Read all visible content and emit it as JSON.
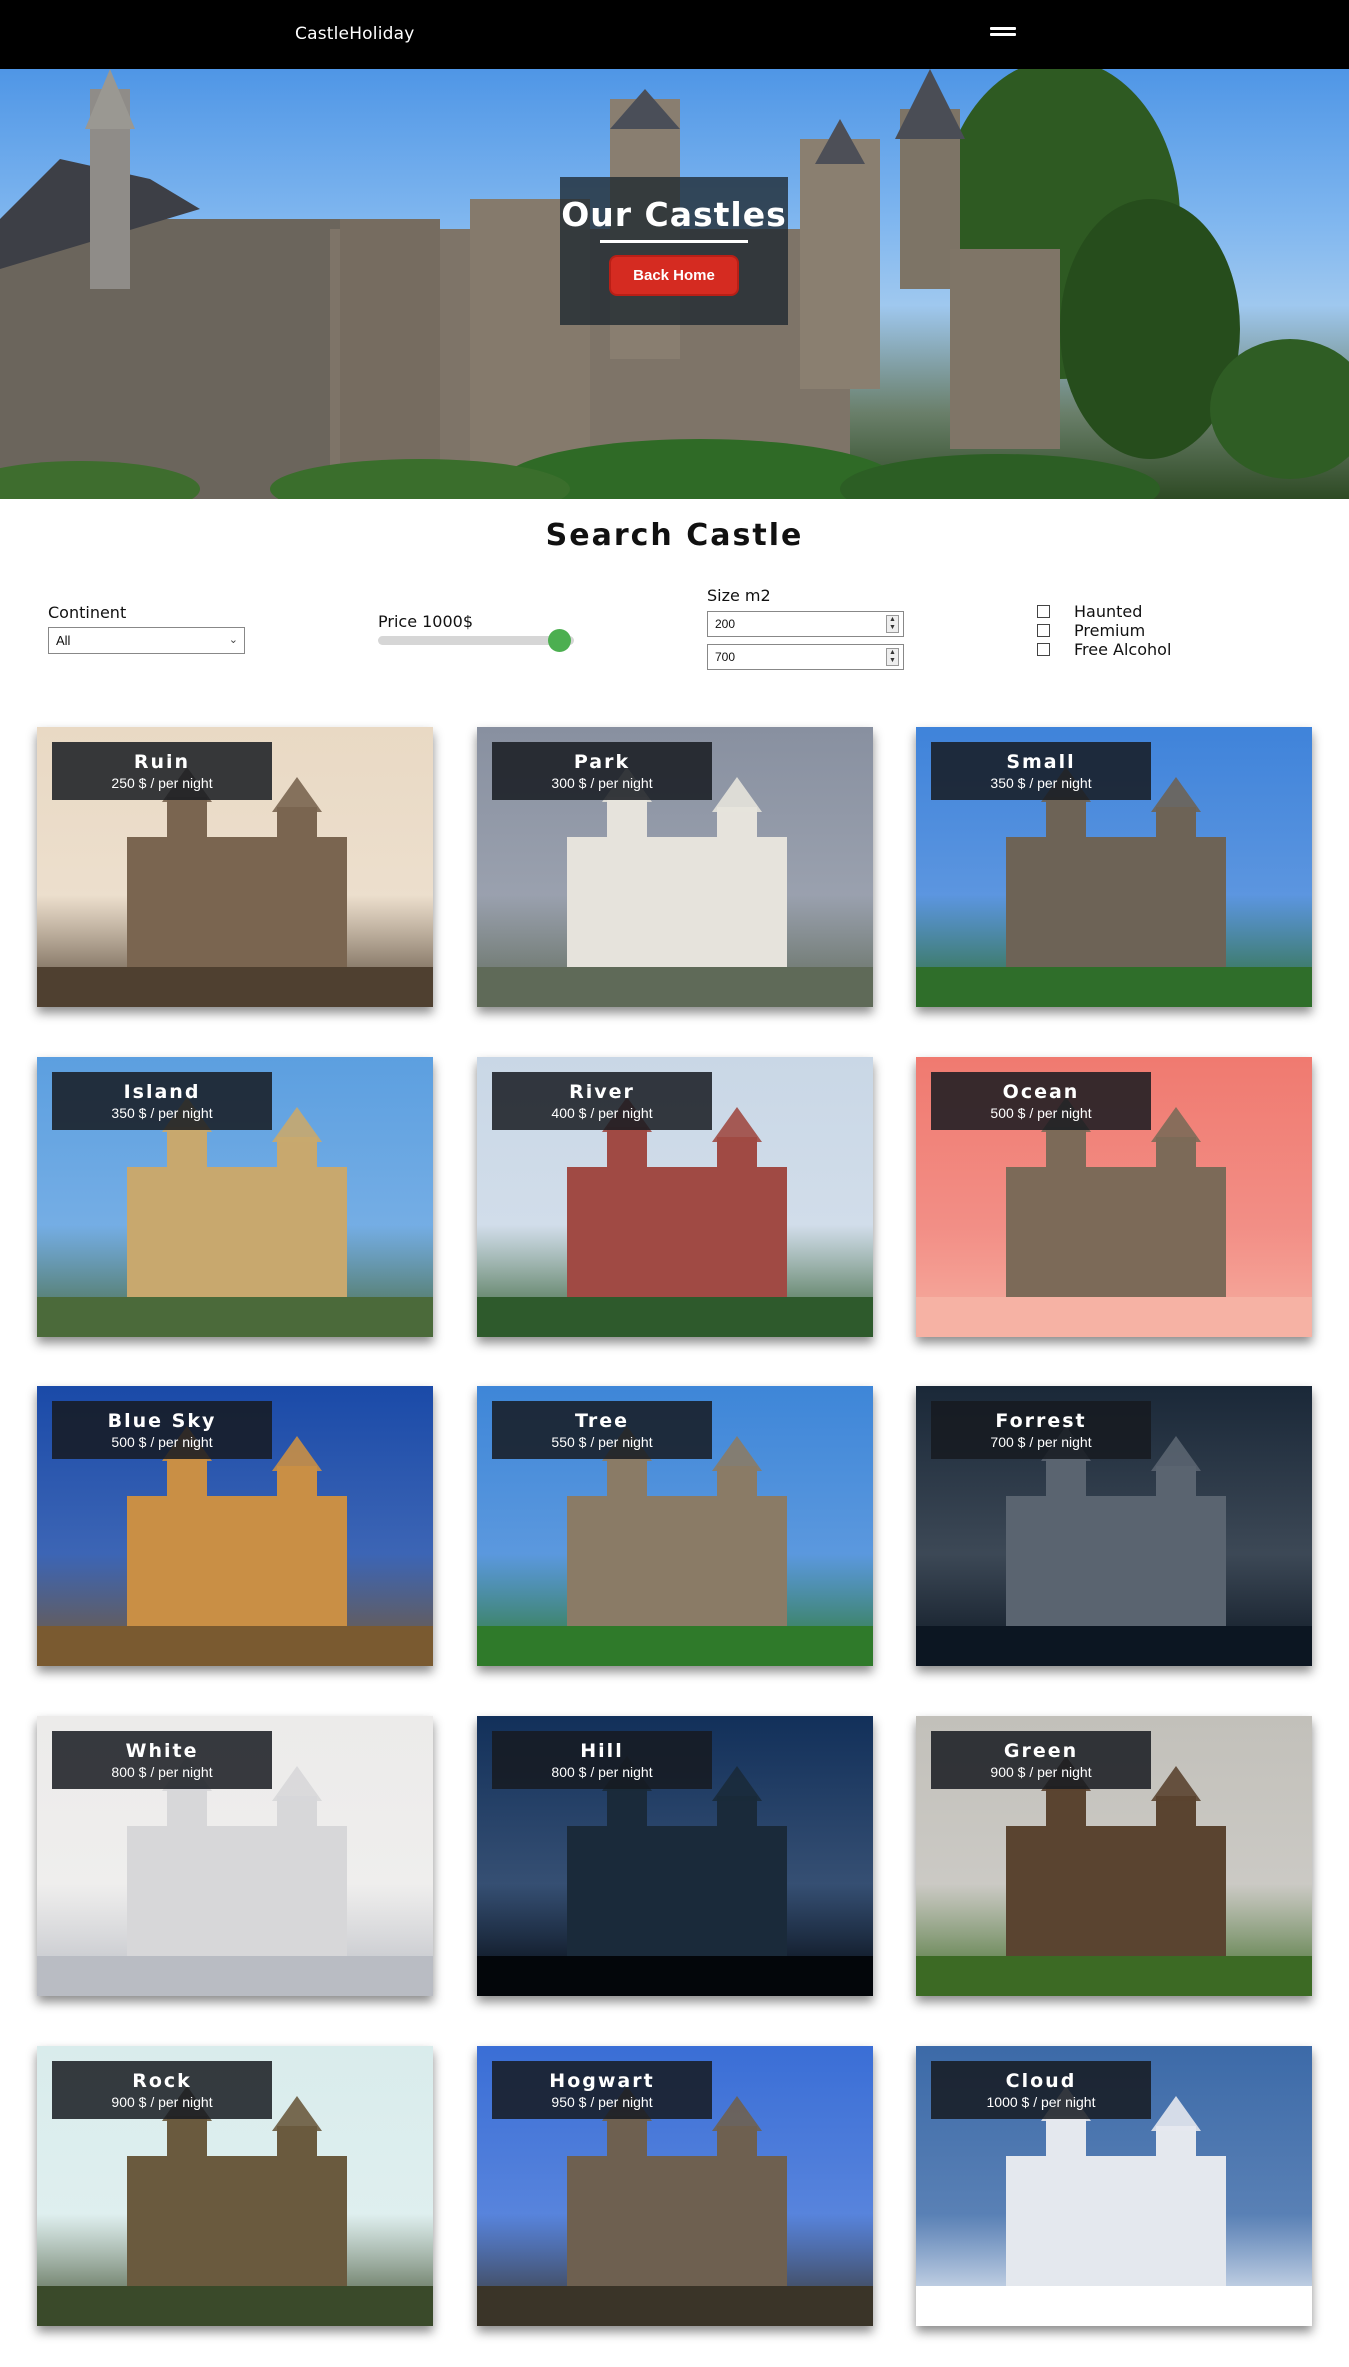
{
  "navbar": {
    "brand": "CastleHoliday",
    "menu_icon": "hamburger-menu-icon"
  },
  "hero": {
    "title": "Our Castles",
    "back_button": "Back Home"
  },
  "search": {
    "title": "Search Castle",
    "continent_label": "Continent",
    "continent_value": "All",
    "price_label": "Price 1000$",
    "price_slider_fraction": 0.95,
    "size_label": "Size m2",
    "size_min": "200",
    "size_max": "700",
    "checkboxes": [
      {
        "label": "Haunted",
        "checked": false
      },
      {
        "label": "Premium",
        "checked": false
      },
      {
        "label": "Free Alcohol",
        "checked": false
      }
    ]
  },
  "colors": {
    "accent_red": "#d52b21",
    "slider_green": "#4caf50",
    "nav_bg": "#000000"
  },
  "castles": [
    {
      "name": "Ruin",
      "price": "250 $ / per night",
      "palette": [
        "#e9d9c4",
        "#7a6550",
        "#4f4030"
      ]
    },
    {
      "name": "Park",
      "price": "300 $ / per night",
      "palette": [
        "#8890a0",
        "#e6e3dc",
        "#5f6a58"
      ]
    },
    {
      "name": "Small",
      "price": "350 $ / per night",
      "palette": [
        "#3f83da",
        "#6d6356",
        "#2f6e2a"
      ]
    },
    {
      "name": "Island",
      "price": "350 $ / per night",
      "palette": [
        "#5c9fe0",
        "#c8a86e",
        "#4b6a3a"
      ]
    },
    {
      "name": "River",
      "price": "400 $ / per night",
      "palette": [
        "#c9d7e6",
        "#a04a44",
        "#2e5a2c"
      ]
    },
    {
      "name": "Ocean",
      "price": "500 $ / per night",
      "palette": [
        "#f07a70",
        "#7c6a58",
        "#f6b2a4"
      ]
    },
    {
      "name": "Blue Sky",
      "price": "500 $ / per night",
      "palette": [
        "#1a4aa8",
        "#c98f45",
        "#7a5a30"
      ]
    },
    {
      "name": "Tree",
      "price": "550 $ / per night",
      "palette": [
        "#3e86d8",
        "#8a7b66",
        "#2f7a2a"
      ]
    },
    {
      "name": "Forrest",
      "price": "700 $ / per night",
      "palette": [
        "#1a2838",
        "#5a6470",
        "#0c1622"
      ]
    },
    {
      "name": "White",
      "price": "800 $ / per night",
      "palette": [
        "#ecebea",
        "#d7d7d9",
        "#b9bcc3"
      ]
    },
    {
      "name": "Hill",
      "price": "800 $ / per night",
      "palette": [
        "#12305a",
        "#1a2a3a",
        "#03060a"
      ]
    },
    {
      "name": "Green",
      "price": "900 $ / per night",
      "palette": [
        "#c2c0ba",
        "#5a4430",
        "#3c6a24"
      ]
    },
    {
      "name": "Rock",
      "price": "900 $ / per night",
      "palette": [
        "#d9ecec",
        "#6a5a3e",
        "#3a4a2a"
      ]
    },
    {
      "name": "Hogwart",
      "price": "950 $ / per night",
      "palette": [
        "#3a6ed6",
        "#6e6050",
        "#3a3428"
      ]
    },
    {
      "name": "Cloud",
      "price": "1000 $ / per night",
      "palette": [
        "#3c6aa8",
        "#e4e8ee",
        "#ffffff"
      ]
    }
  ]
}
